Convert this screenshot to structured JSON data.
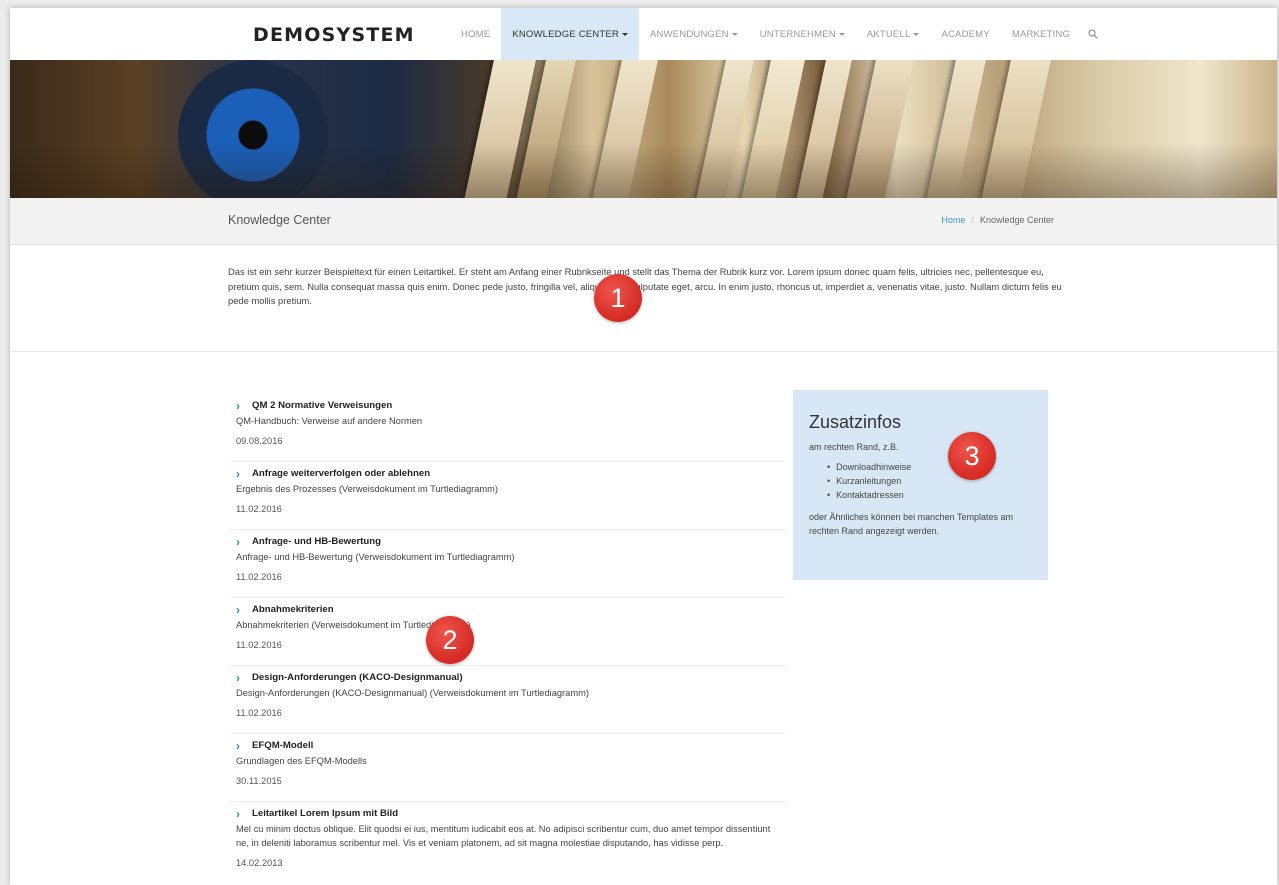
{
  "header": {
    "logo": "DEMOSYSTEM",
    "nav": [
      {
        "label": "HOME",
        "dropdown": false,
        "active": false
      },
      {
        "label": "KNOWLEDGE CENTER",
        "dropdown": true,
        "active": true
      },
      {
        "label": "ANWENDUNGEN",
        "dropdown": true,
        "active": false
      },
      {
        "label": "UNTERNEHMEN",
        "dropdown": true,
        "active": false
      },
      {
        "label": "AKTUELL",
        "dropdown": true,
        "active": false
      },
      {
        "label": "ACADEMY",
        "dropdown": false,
        "active": false
      },
      {
        "label": "MARKETING",
        "dropdown": false,
        "active": false
      }
    ],
    "search_icon": "search-icon"
  },
  "page": {
    "title": "Knowledge Center",
    "breadcrumb": {
      "home": "Home",
      "separator": "/",
      "current": "Knowledge Center"
    },
    "intro": "Das ist ein sehr kurzer Beispieltext für einen Leitartikel. Er steht am Anfang einer Rubrikseite und stellt das Thema der Rubrik kurz vor. Lorem ipsum donec quam felis, ultricies nec, pellentesque eu, pretium quis, sem. Nulla consequat massa quis enim. Donec pede justo, fringilla vel, aliquet nec, vulputate eget, arcu. In enim justo, rhoncus ut, imperdiet a, venenatis vitae, justo. Nullam dictum felis eu pede mollis pretium."
  },
  "articles": [
    {
      "title": "QM 2 Normative Verweisungen",
      "desc": "QM-Handbuch: Verweise auf andere Normen",
      "date": "09.08.2016"
    },
    {
      "title": "Anfrage weiterverfolgen oder ablehnen",
      "desc": "Ergebnis des Prozesses (Verweisdokument im Turtlediagramm)",
      "date": "11.02.2016"
    },
    {
      "title": "Anfrage- und HB-Bewertung",
      "desc": "Anfrage- und HB-Bewertung (Verweisdokument im Turtlediagramm)",
      "date": "11.02.2016"
    },
    {
      "title": "Abnahmekriterien",
      "desc": "Abnahmekriterien (Verweisdokument im Turtlediagramm)",
      "date": "11.02.2016"
    },
    {
      "title": "Design-Anforderungen (KACO-Designmanual)",
      "desc": "Design-Anforderungen (KACO-Designmanual) (Verweisdokument im Turtlediagramm)",
      "date": "11.02.2016"
    },
    {
      "title": "EFQM-Modell",
      "desc": "Grundlagen des EFQM-Modells",
      "date": "30.11.2015"
    },
    {
      "title": "Leitartikel Lorem Ipsum mit Bild",
      "desc": "Mel cu minim doctus oblique. Elit quodsi ei ius, mentitum iudicabit eos at. No adipisci scribentur cum, duo amet tempor dissentiunt ne, in deleniti laboramus scribentur mel. Vis et veniam platonem, ad sit magna molestiae disputando, has vidisse perp.",
      "date": "14.02.2013"
    }
  ],
  "sidebar": {
    "title": "Zusatzinfos",
    "subtitle": "am rechten Rand, z.B.",
    "items": [
      "Downloadhinweise",
      "Kurzanleitungen",
      "Kontaktadressen"
    ],
    "note": "oder Ähnliches können bei manchen Templates am rechten Rand angezeigt werden."
  },
  "markers": [
    "1",
    "2",
    "3"
  ],
  "colors": {
    "accent": "#1f8fd6",
    "nav_active_bg": "#d8e8f6",
    "sidebar_bg": "#d7e7f6",
    "marker": "#d42a23"
  }
}
